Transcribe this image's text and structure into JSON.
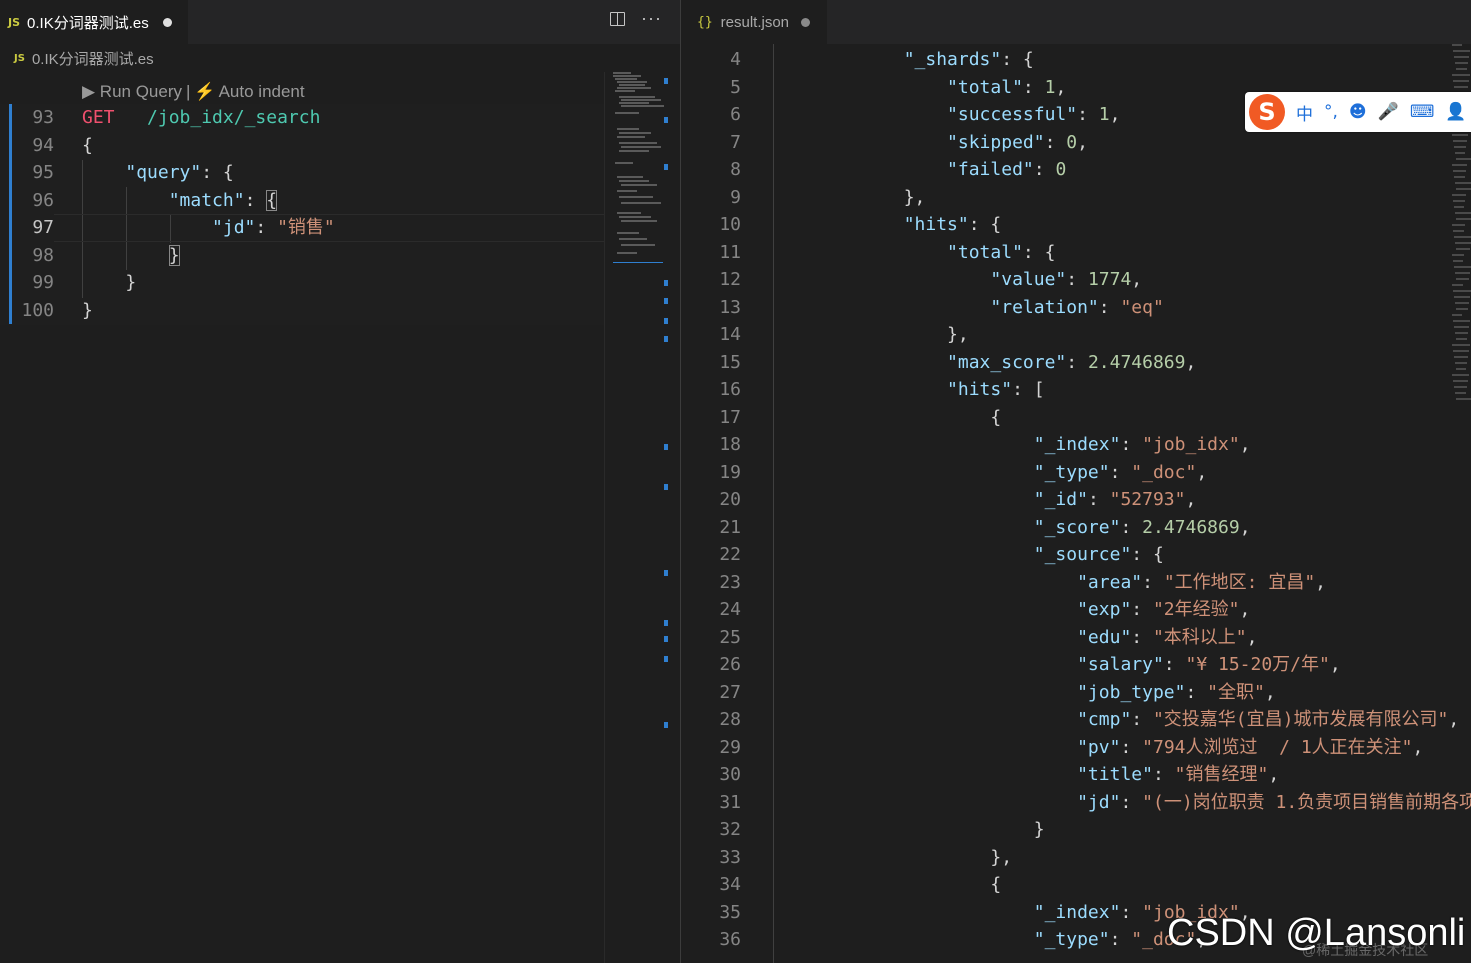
{
  "left": {
    "tab": {
      "badge": "JS",
      "title": "0.IK分词器测试.es"
    },
    "breadcrumb": {
      "badge": "JS",
      "file": "0.IK分词器测试.es"
    },
    "codelens": {
      "run": "Run Query",
      "separator": "|",
      "auto_indent": "Auto indent"
    },
    "lines": [
      {
        "n": "93",
        "tokens": [
          [
            "get",
            "GET"
          ],
          [
            "p",
            "   "
          ],
          [
            "url",
            "/job_idx/_search"
          ]
        ]
      },
      {
        "n": "94",
        "tokens": [
          [
            "p",
            "{"
          ]
        ]
      },
      {
        "n": "95",
        "tokens": [
          [
            "p",
            "    "
          ],
          [
            "k",
            "\"query\""
          ],
          [
            "p",
            ": {"
          ]
        ]
      },
      {
        "n": "96",
        "tokens": [
          [
            "p",
            "        "
          ],
          [
            "k",
            "\"match\""
          ],
          [
            "p",
            ": "
          ],
          [
            "bm",
            "{"
          ]
        ]
      },
      {
        "n": "97",
        "tokens": [
          [
            "p",
            "            "
          ],
          [
            "k",
            "\"jd\""
          ],
          [
            "p",
            ": "
          ],
          [
            "s",
            "\"销售\""
          ]
        ],
        "active": true
      },
      {
        "n": "98",
        "tokens": [
          [
            "p",
            "        "
          ],
          [
            "bm",
            "}"
          ]
        ]
      },
      {
        "n": "99",
        "tokens": [
          [
            "p",
            "    }"
          ]
        ]
      },
      {
        "n": "100",
        "tokens": [
          [
            "p",
            "}"
          ]
        ]
      }
    ]
  },
  "right": {
    "tab": {
      "badge": "{}",
      "title": "result.json"
    },
    "lines": [
      {
        "n": "4",
        "tokens": [
          [
            "p",
            "        "
          ],
          [
            "k",
            "\"_shards\""
          ],
          [
            "p",
            ": {"
          ]
        ]
      },
      {
        "n": "5",
        "tokens": [
          [
            "p",
            "            "
          ],
          [
            "k",
            "\"total\""
          ],
          [
            "p",
            ": "
          ],
          [
            "n",
            "1"
          ],
          [
            "p",
            ","
          ]
        ]
      },
      {
        "n": "6",
        "tokens": [
          [
            "p",
            "            "
          ],
          [
            "k",
            "\"successful\""
          ],
          [
            "p",
            ": "
          ],
          [
            "n",
            "1"
          ],
          [
            "p",
            ","
          ]
        ]
      },
      {
        "n": "7",
        "tokens": [
          [
            "p",
            "            "
          ],
          [
            "k",
            "\"skipped\""
          ],
          [
            "p",
            ": "
          ],
          [
            "n",
            "0"
          ],
          [
            "p",
            ","
          ]
        ]
      },
      {
        "n": "8",
        "tokens": [
          [
            "p",
            "            "
          ],
          [
            "k",
            "\"failed\""
          ],
          [
            "p",
            ": "
          ],
          [
            "n",
            "0"
          ]
        ]
      },
      {
        "n": "9",
        "tokens": [
          [
            "p",
            "        },"
          ]
        ]
      },
      {
        "n": "10",
        "tokens": [
          [
            "p",
            "        "
          ],
          [
            "k",
            "\"hits\""
          ],
          [
            "p",
            ": {"
          ]
        ]
      },
      {
        "n": "11",
        "tokens": [
          [
            "p",
            "            "
          ],
          [
            "k",
            "\"total\""
          ],
          [
            "p",
            ": {"
          ]
        ]
      },
      {
        "n": "12",
        "tokens": [
          [
            "p",
            "                "
          ],
          [
            "k",
            "\"value\""
          ],
          [
            "p",
            ": "
          ],
          [
            "n",
            "1774"
          ],
          [
            "p",
            ","
          ]
        ]
      },
      {
        "n": "13",
        "tokens": [
          [
            "p",
            "                "
          ],
          [
            "k",
            "\"relation\""
          ],
          [
            "p",
            ": "
          ],
          [
            "s",
            "\"eq\""
          ]
        ]
      },
      {
        "n": "14",
        "tokens": [
          [
            "p",
            "            },"
          ]
        ]
      },
      {
        "n": "15",
        "tokens": [
          [
            "p",
            "            "
          ],
          [
            "k",
            "\"max_score\""
          ],
          [
            "p",
            ": "
          ],
          [
            "n",
            "2.4746869"
          ],
          [
            "p",
            ","
          ]
        ]
      },
      {
        "n": "16",
        "tokens": [
          [
            "p",
            "            "
          ],
          [
            "k",
            "\"hits\""
          ],
          [
            "p",
            ": ["
          ]
        ]
      },
      {
        "n": "17",
        "tokens": [
          [
            "p",
            "                {"
          ]
        ]
      },
      {
        "n": "18",
        "tokens": [
          [
            "p",
            "                    "
          ],
          [
            "k",
            "\"_index\""
          ],
          [
            "p",
            ": "
          ],
          [
            "s",
            "\"job_idx\""
          ],
          [
            "p",
            ","
          ]
        ]
      },
      {
        "n": "19",
        "tokens": [
          [
            "p",
            "                    "
          ],
          [
            "k",
            "\"_type\""
          ],
          [
            "p",
            ": "
          ],
          [
            "s",
            "\"_doc\""
          ],
          [
            "p",
            ","
          ]
        ]
      },
      {
        "n": "20",
        "tokens": [
          [
            "p",
            "                    "
          ],
          [
            "k",
            "\"_id\""
          ],
          [
            "p",
            ": "
          ],
          [
            "s",
            "\"52793\""
          ],
          [
            "p",
            ","
          ]
        ]
      },
      {
        "n": "21",
        "tokens": [
          [
            "p",
            "                    "
          ],
          [
            "k",
            "\"_score\""
          ],
          [
            "p",
            ": "
          ],
          [
            "n",
            "2.4746869"
          ],
          [
            "p",
            ","
          ]
        ]
      },
      {
        "n": "22",
        "tokens": [
          [
            "p",
            "                    "
          ],
          [
            "k",
            "\"_source\""
          ],
          [
            "p",
            ": {"
          ]
        ]
      },
      {
        "n": "23",
        "tokens": [
          [
            "p",
            "                        "
          ],
          [
            "k",
            "\"area\""
          ],
          [
            "p",
            ": "
          ],
          [
            "s",
            "\"工作地区: 宜昌\""
          ],
          [
            "p",
            ","
          ]
        ]
      },
      {
        "n": "24",
        "tokens": [
          [
            "p",
            "                        "
          ],
          [
            "k",
            "\"exp\""
          ],
          [
            "p",
            ": "
          ],
          [
            "s",
            "\"2年经验\""
          ],
          [
            "p",
            ","
          ]
        ]
      },
      {
        "n": "25",
        "tokens": [
          [
            "p",
            "                        "
          ],
          [
            "k",
            "\"edu\""
          ],
          [
            "p",
            ": "
          ],
          [
            "s",
            "\"本科以上\""
          ],
          [
            "p",
            ","
          ]
        ]
      },
      {
        "n": "26",
        "tokens": [
          [
            "p",
            "                        "
          ],
          [
            "k",
            "\"salary\""
          ],
          [
            "p",
            ": "
          ],
          [
            "s",
            "\"¥ 15-20万/年\""
          ],
          [
            "p",
            ","
          ]
        ]
      },
      {
        "n": "27",
        "tokens": [
          [
            "p",
            "                        "
          ],
          [
            "k",
            "\"job_type\""
          ],
          [
            "p",
            ": "
          ],
          [
            "s",
            "\"全职\""
          ],
          [
            "p",
            ","
          ]
        ]
      },
      {
        "n": "28",
        "tokens": [
          [
            "p",
            "                        "
          ],
          [
            "k",
            "\"cmp\""
          ],
          [
            "p",
            ": "
          ],
          [
            "s",
            "\"交投嘉华(宜昌)城市发展有限公司\""
          ],
          [
            "p",
            ","
          ]
        ]
      },
      {
        "n": "29",
        "tokens": [
          [
            "p",
            "                        "
          ],
          [
            "k",
            "\"pv\""
          ],
          [
            "p",
            ": "
          ],
          [
            "s",
            "\"794人浏览过  / 1人正在关注\""
          ],
          [
            "p",
            ","
          ]
        ]
      },
      {
        "n": "30",
        "tokens": [
          [
            "p",
            "                        "
          ],
          [
            "k",
            "\"title\""
          ],
          [
            "p",
            ": "
          ],
          [
            "s",
            "\"销售经理\""
          ],
          [
            "p",
            ","
          ]
        ]
      },
      {
        "n": "31",
        "tokens": [
          [
            "p",
            "                        "
          ],
          [
            "k",
            "\"jd\""
          ],
          [
            "p",
            ": "
          ],
          [
            "s",
            "\"(一)岗位职责 1.负责项目销售前期各项"
          ]
        ]
      },
      {
        "n": "32",
        "tokens": [
          [
            "p",
            "                    }"
          ]
        ]
      },
      {
        "n": "33",
        "tokens": [
          [
            "p",
            "                },"
          ]
        ]
      },
      {
        "n": "34",
        "tokens": [
          [
            "p",
            "                {"
          ]
        ]
      },
      {
        "n": "35",
        "tokens": [
          [
            "p",
            "                    "
          ],
          [
            "k",
            "\"_index\""
          ],
          [
            "p",
            ": "
          ],
          [
            "s",
            "\"job_idx\""
          ],
          [
            "p",
            ","
          ]
        ]
      },
      {
        "n": "36",
        "tokens": [
          [
            "p",
            "                    "
          ],
          [
            "k",
            "\"_type\""
          ],
          [
            "p",
            ": "
          ],
          [
            "s",
            "\"_doc\""
          ],
          [
            "p",
            ","
          ]
        ]
      }
    ]
  },
  "ime": {
    "logo": "S",
    "mode": "中",
    "punct": "°,",
    "emoji": "☻",
    "mic": "🎤",
    "keyboard": "⌨",
    "user": "👤"
  },
  "watermark": {
    "text": "CSDN @Lansonli",
    "sub": "@稀土掘金技术社区"
  },
  "colors": {
    "key": "#9cdcfe",
    "string": "#ce9178",
    "number": "#b5cea8",
    "method": "#f0506e",
    "url": "#4ec9b0",
    "modified_bar": "#2f7fd0"
  }
}
